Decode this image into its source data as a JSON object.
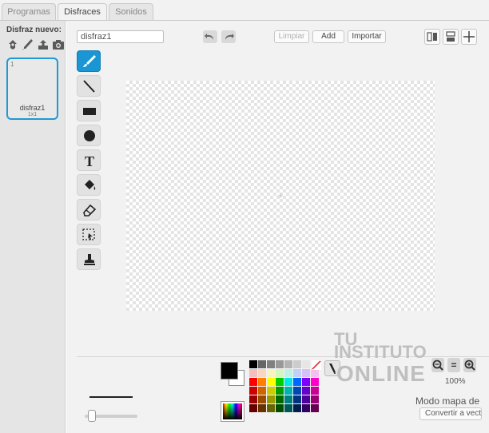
{
  "tabs": [
    {
      "label": "Programas"
    },
    {
      "label": "Disfraces"
    },
    {
      "label": "Sonidos"
    }
  ],
  "active_tab": "Disfraces",
  "sidebar": {
    "new_costume_label": "Disfraz nuevo:",
    "new_costume_icons": [
      "sprite-library-icon",
      "paint-brush-icon",
      "upload-icon",
      "camera-icon"
    ],
    "costumes": [
      {
        "number": "1",
        "name": "disfraz1",
        "size": "1x1"
      }
    ]
  },
  "toolbar": {
    "name_value": "disfraz1",
    "clear_label": "Limpiar",
    "add_label": "Add",
    "import_label": "Importar"
  },
  "tools": [
    "brush-icon",
    "line-icon",
    "rectangle-icon",
    "ellipse-icon",
    "text-icon",
    "fill-icon",
    "eraser-icon",
    "select-icon",
    "stamp-icon"
  ],
  "text_tool_glyph": "T",
  "colors": {
    "accent": "#1a96d4",
    "primary": "#000000",
    "secondary": "#ffffff"
  },
  "palette": [
    "#000000",
    "#666666",
    "#808080",
    "#999999",
    "#b3b3b3",
    "#cccccc",
    "#e6e6e6",
    "#ffffff",
    "#f4bfbf",
    "#f7d7bf",
    "#f7f5bf",
    "#d4f7bf",
    "#bff2e6",
    "#bfd1f7",
    "#d7bff7",
    "#f5bff0",
    "#ff0000",
    "#ff8000",
    "#ffff00",
    "#00cc00",
    "#00e6e6",
    "#0066ff",
    "#8000ff",
    "#ff00cc",
    "#cc0000",
    "#cc6600",
    "#cccc00",
    "#009900",
    "#00b3b3",
    "#0047b3",
    "#6600cc",
    "#cc0099",
    "#990000",
    "#994c00",
    "#999900",
    "#006600",
    "#008080",
    "#003380",
    "#4c0099",
    "#990073",
    "#660000",
    "#663300",
    "#666600",
    "#004d00",
    "#005959",
    "#001f4d",
    "#330066",
    "#660050"
  ],
  "watermark": {
    "line1": "TU",
    "line2": "INSTITUTO",
    "line3": "ONLINE"
  },
  "zoom": {
    "out": "−",
    "reset": "=",
    "in": "+",
    "level": "100%"
  },
  "mode_label": "Modo mapa de b",
  "convert_label": "Convertir a vecto"
}
